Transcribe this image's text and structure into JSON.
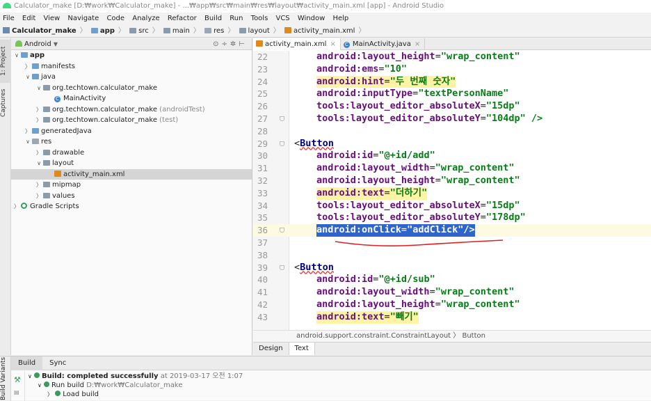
{
  "window": {
    "title": "Calculator_make [D:₩work₩Calculator_make] - ...₩app₩src₩main₩res₩layout₩activity_main.xml [app] - Android Studio"
  },
  "menu": [
    "File",
    "Edit",
    "View",
    "Navigate",
    "Code",
    "Analyze",
    "Refactor",
    "Build",
    "Run",
    "Tools",
    "VCS",
    "Window",
    "Help"
  ],
  "breadcrumb": [
    "Calculator_make",
    "app",
    "src",
    "main",
    "res",
    "layout",
    "activity_main.xml"
  ],
  "left_strip": {
    "project_tab": "1: Project",
    "captures_tab": "Captures"
  },
  "project_panel": {
    "view_mode": "Android",
    "tree": [
      {
        "label": "app",
        "suffix": ""
      },
      {
        "label": "manifests",
        "suffix": ""
      },
      {
        "label": "java",
        "suffix": ""
      },
      {
        "label": "org.techtown.calculator_make",
        "suffix": ""
      },
      {
        "label": "MainActivity",
        "suffix": ""
      },
      {
        "label": "org.techtown.calculator_make",
        "suffix": "(androidTest)"
      },
      {
        "label": "org.techtown.calculator_make",
        "suffix": "(test)"
      },
      {
        "label": "generatedJava",
        "suffix": ""
      },
      {
        "label": "res",
        "suffix": ""
      },
      {
        "label": "drawable",
        "suffix": ""
      },
      {
        "label": "layout",
        "suffix": ""
      },
      {
        "label": "activity_main.xml",
        "suffix": ""
      },
      {
        "label": "mipmap",
        "suffix": ""
      },
      {
        "label": "values",
        "suffix": ""
      },
      {
        "label": "Gradle Scripts",
        "suffix": ""
      }
    ]
  },
  "editor": {
    "tabs": [
      {
        "label": "activity_main.xml",
        "close": "×"
      },
      {
        "label": "MainActivity.java",
        "close": "×"
      }
    ],
    "lines": [
      {
        "n": "22",
        "a": "android:layout_height",
        "v": "\"wrap_content\""
      },
      {
        "n": "23",
        "a": "android:ems",
        "v": "\"10\""
      },
      {
        "n": "24",
        "a": "android:hint",
        "v": "\"두 번째 숫자\""
      },
      {
        "n": "25",
        "a": "android:inputType",
        "v": "\"textPersonName\""
      },
      {
        "n": "26",
        "a": "tools:layout_editor_absoluteX",
        "v": "\"15dp\""
      },
      {
        "n": "27",
        "a": "tools:layout_editor_absoluteY",
        "v": "\"104dp\" />"
      },
      {
        "n": "28"
      },
      {
        "n": "29",
        "tag_open": "<",
        "tag": "Button"
      },
      {
        "n": "30",
        "a": "android:id",
        "v": "\"@+id/add\""
      },
      {
        "n": "31",
        "a": "android:layout_width",
        "v": "\"wrap_content\""
      },
      {
        "n": "32",
        "a": "android:layout_height",
        "v": "\"wrap_content\""
      },
      {
        "n": "33",
        "a": "android:text",
        "v": "\"더하기\""
      },
      {
        "n": "34",
        "a": "tools:layout_editor_absoluteX",
        "v": "\"15dp\""
      },
      {
        "n": "35",
        "a": "tools:layout_editor_absoluteY",
        "v": "\"178dp\""
      },
      {
        "n": "36",
        "a": "android:onClick",
        "v": "\"addClick\"/>"
      },
      {
        "n": "37"
      },
      {
        "n": "38"
      },
      {
        "n": "39",
        "tag_open": "<",
        "tag": "Button"
      },
      {
        "n": "40",
        "a": "android:id",
        "v": "\"@+id/sub\""
      },
      {
        "n": "41",
        "a": "android:layout_width",
        "v": "\"wrap_content\""
      },
      {
        "n": "42",
        "a": "android:layout_height",
        "v": "\"wrap_content\""
      },
      {
        "n": "43",
        "a": "android:text",
        "v": "\"빼기\""
      }
    ],
    "status_crumbs": [
      "android.support.constraint.ConstraintLayout",
      "Button"
    ],
    "design_tabs": [
      "Design",
      "Text"
    ]
  },
  "bottom": {
    "tabs": [
      "Build",
      "Sync"
    ],
    "side_tab": "Build Variants",
    "build_line": "Build: completed successfully",
    "build_time": "at 2019-03-17 오전 1:07",
    "run_build": "Run build",
    "run_build_path": "D:₩work₩Calculator_make",
    "load_build": "Load build"
  }
}
